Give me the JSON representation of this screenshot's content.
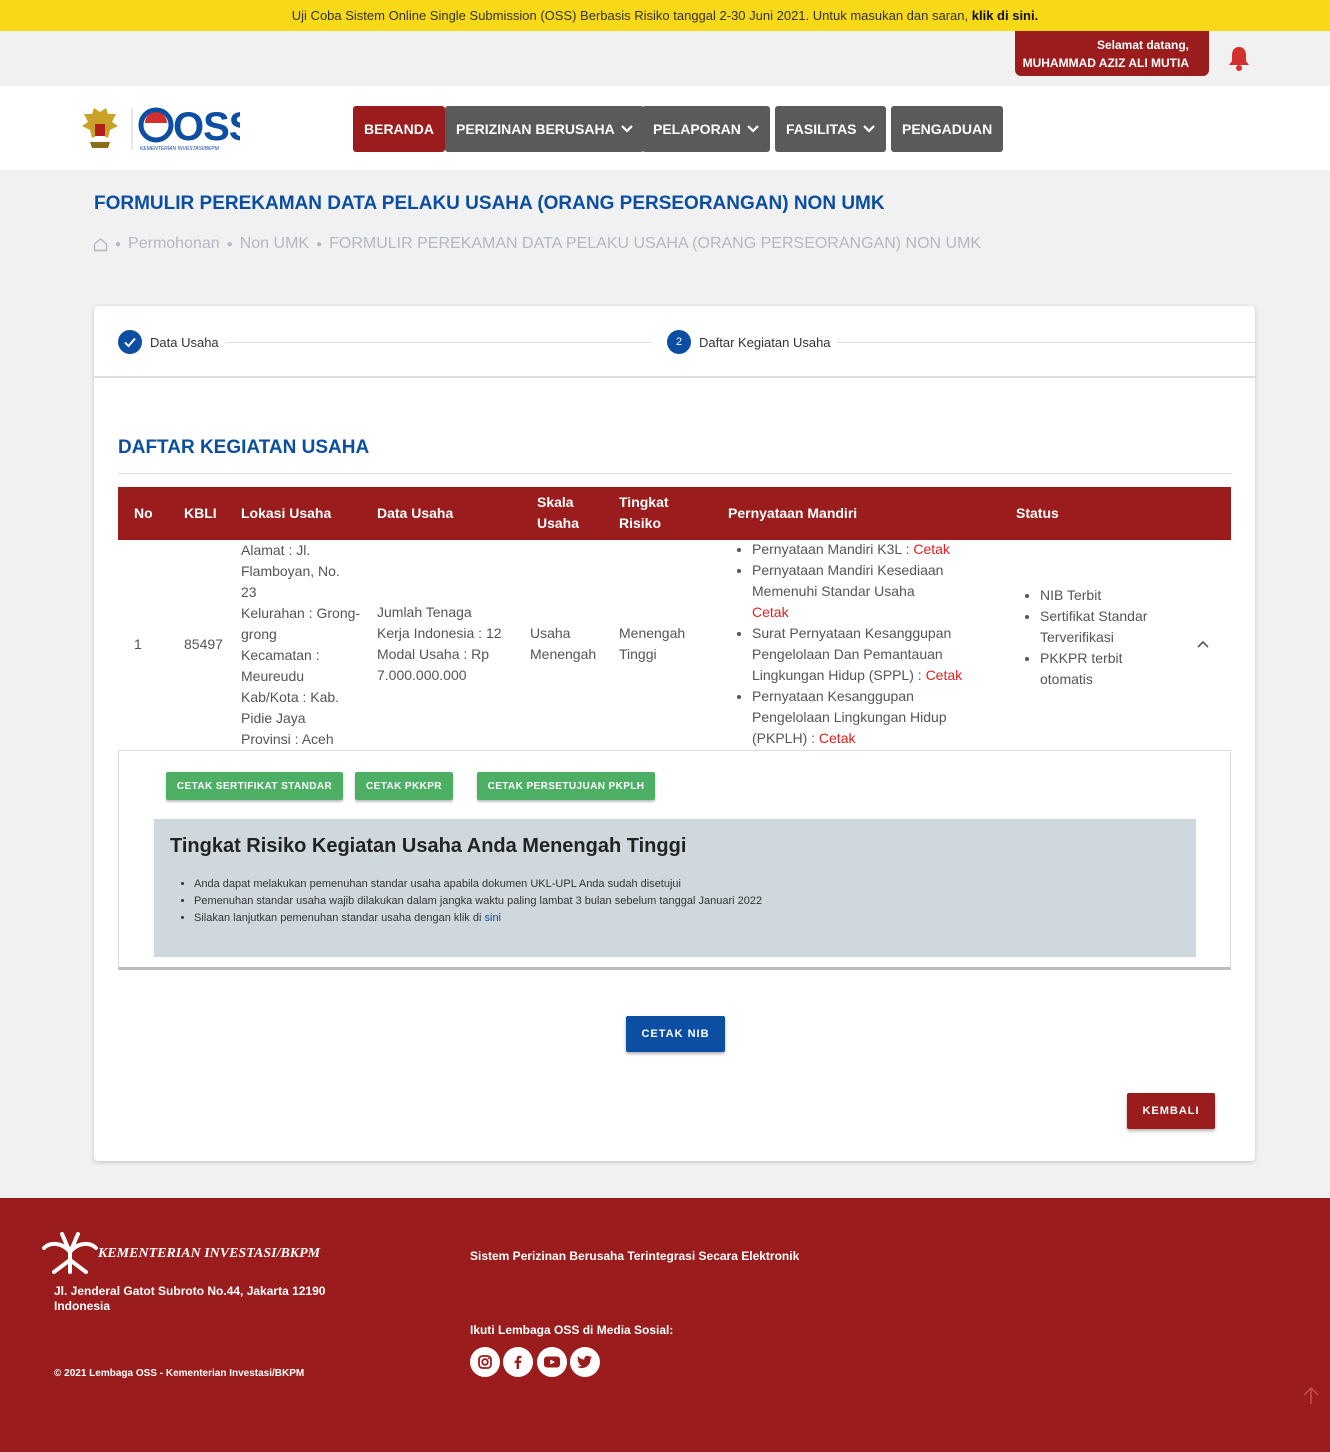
{
  "announcement": {
    "text": "Uji Coba Sistem Online Single Submission (OSS) Berbasis Risiko tanggal 2-30 Juni 2021. Untuk masukan dan saran,",
    "link": "klik di sini."
  },
  "user": {
    "greeting": "Selamat datang,",
    "name": "MUHAMMAD AZIZ ALI MUTIA"
  },
  "logo": {
    "text": "OSS",
    "subtext": "KEMENTERIAN INVESTASI/BKPM"
  },
  "nav": {
    "home": "BERANDA",
    "licensing": "PERIZINAN BERUSAHA",
    "reporting": "PELAPORAN",
    "facilities": "FASILITAS",
    "complaints": "PENGADUAN"
  },
  "page": {
    "title": "FORMULIR PEREKAMAN DATA PELAKU USAHA (ORANG PERSEORANGAN) NON UMK",
    "breadcrumb": [
      "Permohonan",
      "Non UMK",
      "FORMULIR PEREKAMAN DATA PELAKU USAHA (ORANG PERSEORANGAN) NON UMK"
    ]
  },
  "stepper": {
    "step1": "Data Usaha",
    "step2_num": "2",
    "step2": "Daftar Kegiatan Usaha"
  },
  "section_title": "DAFTAR KEGIATAN USAHA",
  "table": {
    "headers": {
      "no": "No",
      "kbli": "KBLI",
      "lokasi": "Lokasi Usaha",
      "data": "Data Usaha",
      "skala1": "Skala",
      "skala2": "Usaha",
      "risiko1": "Tingkat",
      "risiko2": "Risiko",
      "pernyataan": "Pernyataan Mandiri",
      "status": "Status"
    },
    "row": {
      "no": "1",
      "kbli": "85497",
      "lokasi": [
        "Alamat : Jl.",
        "Flamboyan, No.",
        "23",
        "Kelurahan : Grong-",
        "grong",
        "Kecamatan :",
        "Meureudu",
        "Kab/Kota : Kab.",
        "Pidie Jaya",
        "Provinsi : Aceh"
      ],
      "data_usaha": [
        "Jumlah Tenaga",
        "Kerja Indonesia : 12",
        "Modal Usaha : Rp",
        "7.000.000.000"
      ],
      "skala": [
        "Usaha",
        "Menengah"
      ],
      "risiko": [
        "Menengah",
        "Tinggi"
      ],
      "pernyataan": [
        {
          "text": [
            "Pernyataan Mandiri K3L :"
          ],
          "link": "Cetak"
        },
        {
          "text": [
            "Pernyataan Mandiri Kesediaan",
            "Memenuhi Standar Usaha"
          ],
          "link": "Cetak"
        },
        {
          "text": [
            "Surat Pernyataan Kesanggupan",
            "Pengelolaan Dan Pemantauan",
            "Lingkungan Hidup (SPPL) :"
          ],
          "link": "Cetak"
        },
        {
          "text": [
            "Pernyataan Kesanggupan",
            "Pengelolaan Lingkungan Hidup",
            "(PKPLH) :"
          ],
          "link": "Cetak"
        }
      ],
      "status": [
        [
          "NIB Terbit"
        ],
        [
          "Sertifikat Standar",
          "Terverifikasi"
        ],
        [
          "PKKPR terbit",
          "otomatis"
        ]
      ]
    }
  },
  "panel": {
    "btn1": "CETAK SERTIFIKAT STANDAR",
    "btn2": "CETAK PKKPR",
    "btn3": "CETAK PERSETUJUAN PKPLH",
    "risk_title": "Tingkat Risiko Kegiatan Usaha Anda Menengah Tinggi",
    "notes": [
      "Anda dapat melakukan pemenuhan standar usaha apabila dokumen UKL-UPL Anda sudah disetujui",
      "Pemenuhan standar usaha wajib dilakukan dalam jangka waktu paling lambat 3 bulan sebelum tanggal Januari 2022",
      "Silakan lanjutkan pemenuhan standar usaha dengan klik di"
    ],
    "notes_link": "sini"
  },
  "actions": {
    "print_nib": "CETAK NIB",
    "back": "KEMBALI"
  },
  "footer": {
    "brand": "KEMENTERIAN INVESTASI/BKPM",
    "address1": "Jl. Jenderal Gatot Subroto No.44, Jakarta 12190",
    "address2": "Indonesia",
    "copyright": "© 2021 Lembaga OSS - Kementerian Investasi/BKPM",
    "system": "Sistem Perizinan Berusaha Terintegrasi Secara Elektronik",
    "social": "Ikuti Lembaga OSS di Media Sosial:"
  },
  "colors": {
    "brand_red": "#9b1c1c",
    "brand_blue": "#0b4ea2",
    "announce_yellow": "#f7d917",
    "action_green": "#4caf64"
  }
}
